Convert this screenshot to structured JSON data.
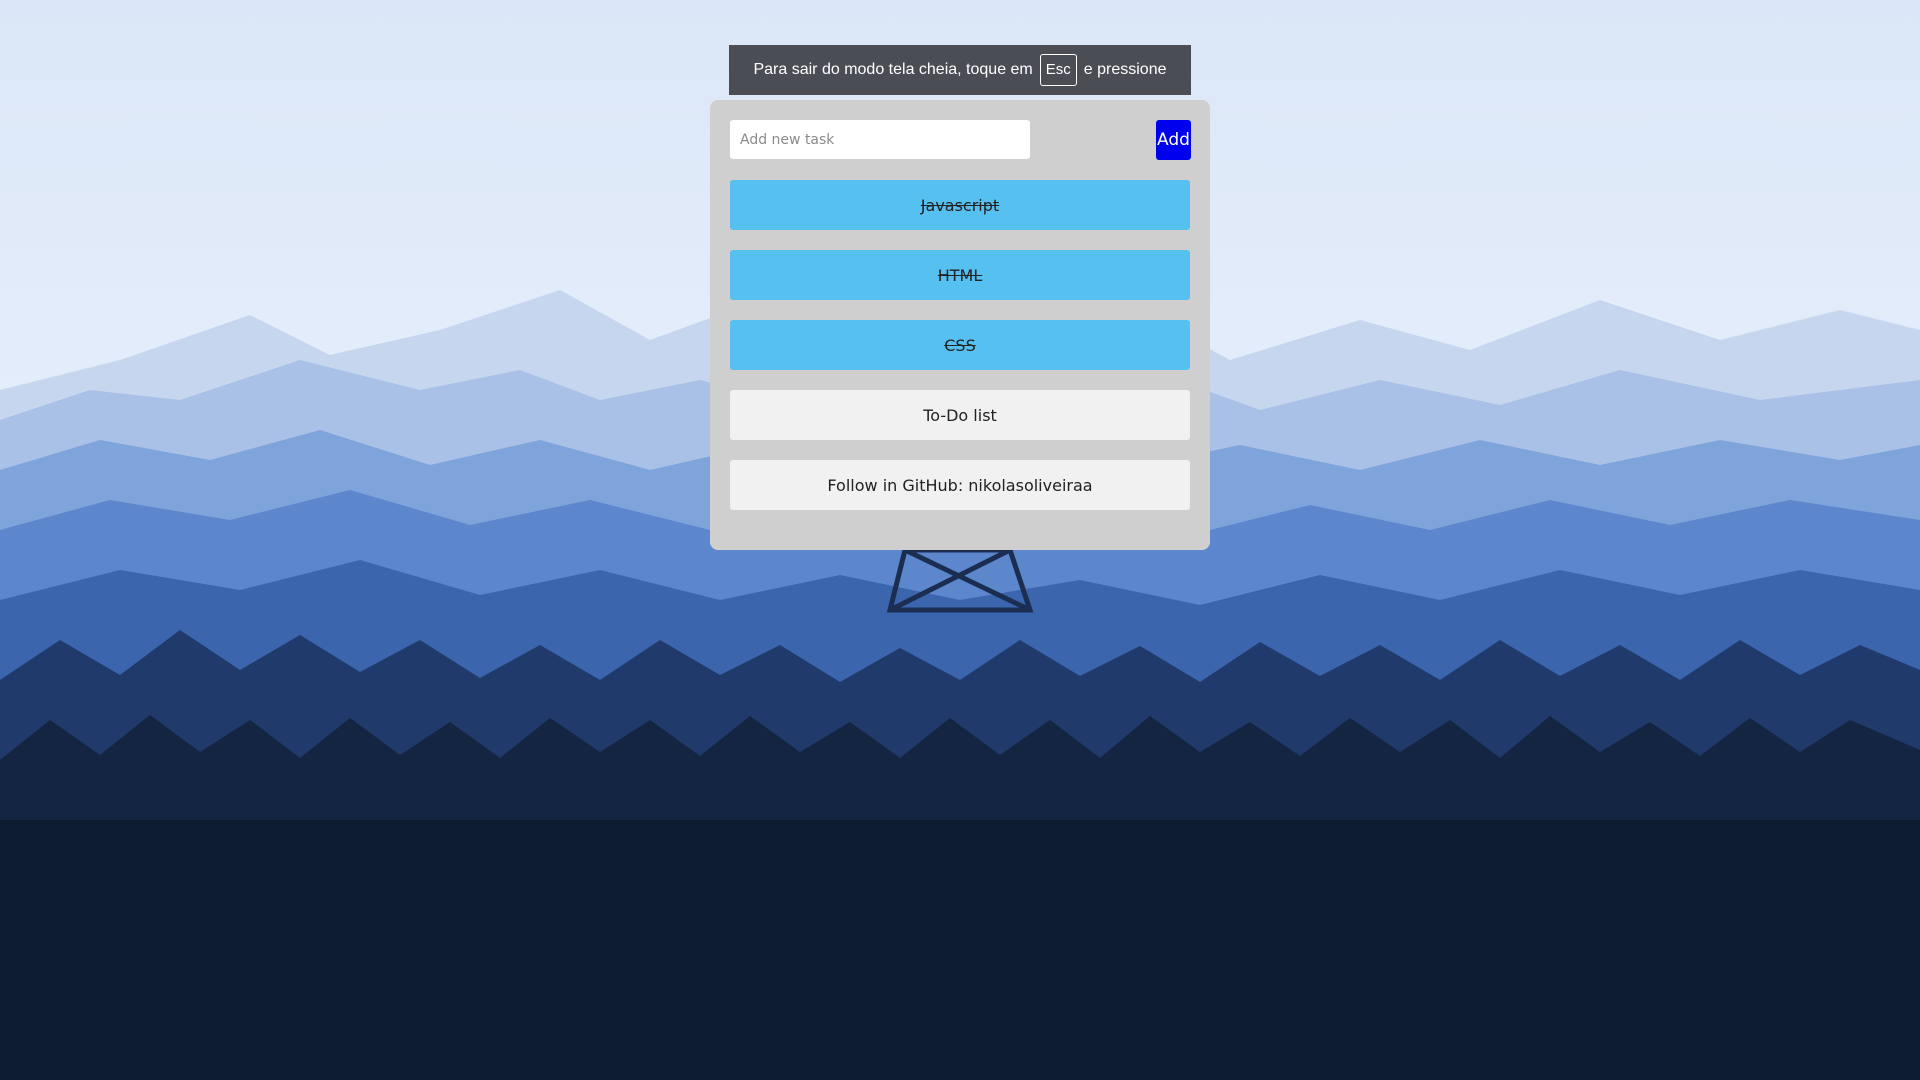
{
  "fullscreen_notice": {
    "text_before": "Para sair do modo tela cheia, toque em",
    "key": "Esc",
    "text_after": "e pressione"
  },
  "todo": {
    "input_placeholder": "Add new task",
    "add_label": "Add",
    "tasks": [
      {
        "label": "Javascript",
        "completed": true
      },
      {
        "label": "HTML",
        "completed": true
      },
      {
        "label": "CSS",
        "completed": true
      }
    ],
    "footer_items": [
      {
        "label": "To-Do list"
      },
      {
        "label": "Follow in GitHub: nikolasoliveiraa"
      }
    ]
  },
  "colors": {
    "completed_task": "#56c0f0",
    "add_button": "#0000ee",
    "panel": "#cfcfcf"
  }
}
